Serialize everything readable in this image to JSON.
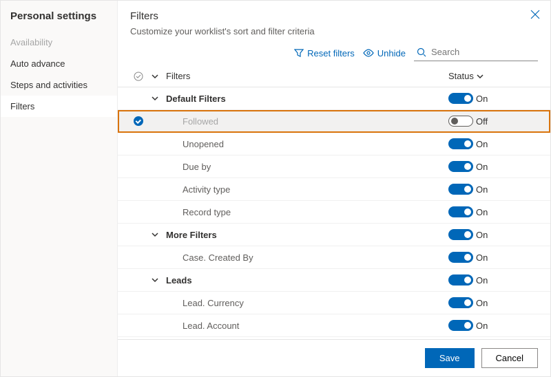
{
  "sidebar": {
    "title": "Personal settings",
    "items": [
      {
        "label": "Availability",
        "disabled": true
      },
      {
        "label": "Auto advance"
      },
      {
        "label": "Steps and activities"
      },
      {
        "label": "Filters",
        "active": true
      }
    ]
  },
  "header": {
    "title": "Filters",
    "subtitle": "Customize your worklist's sort and filter criteria"
  },
  "toolbar": {
    "reset": "Reset filters",
    "unhide": "Unhide",
    "search_placeholder": "Search"
  },
  "columns": {
    "name": "Filters",
    "status": "Status"
  },
  "status_labels": {
    "on": "On",
    "off": "Off"
  },
  "rows": [
    {
      "type": "group",
      "label": "Default Filters",
      "on": true,
      "expanded": true
    },
    {
      "type": "child",
      "label": "Followed",
      "on": false,
      "selected": true,
      "highlight": true
    },
    {
      "type": "child",
      "label": "Unopened",
      "on": true
    },
    {
      "type": "child",
      "label": "Due by",
      "on": true
    },
    {
      "type": "child",
      "label": "Activity type",
      "on": true
    },
    {
      "type": "child",
      "label": "Record type",
      "on": true
    },
    {
      "type": "group",
      "label": "More Filters",
      "on": true,
      "expanded": true
    },
    {
      "type": "child",
      "label": "Case. Created By",
      "on": true
    },
    {
      "type": "group",
      "label": "Leads",
      "on": true,
      "expanded": true
    },
    {
      "type": "child",
      "label": "Lead. Currency",
      "on": true
    },
    {
      "type": "child",
      "label": "Lead. Account",
      "on": true
    }
  ],
  "footer": {
    "save": "Save",
    "cancel": "Cancel"
  }
}
